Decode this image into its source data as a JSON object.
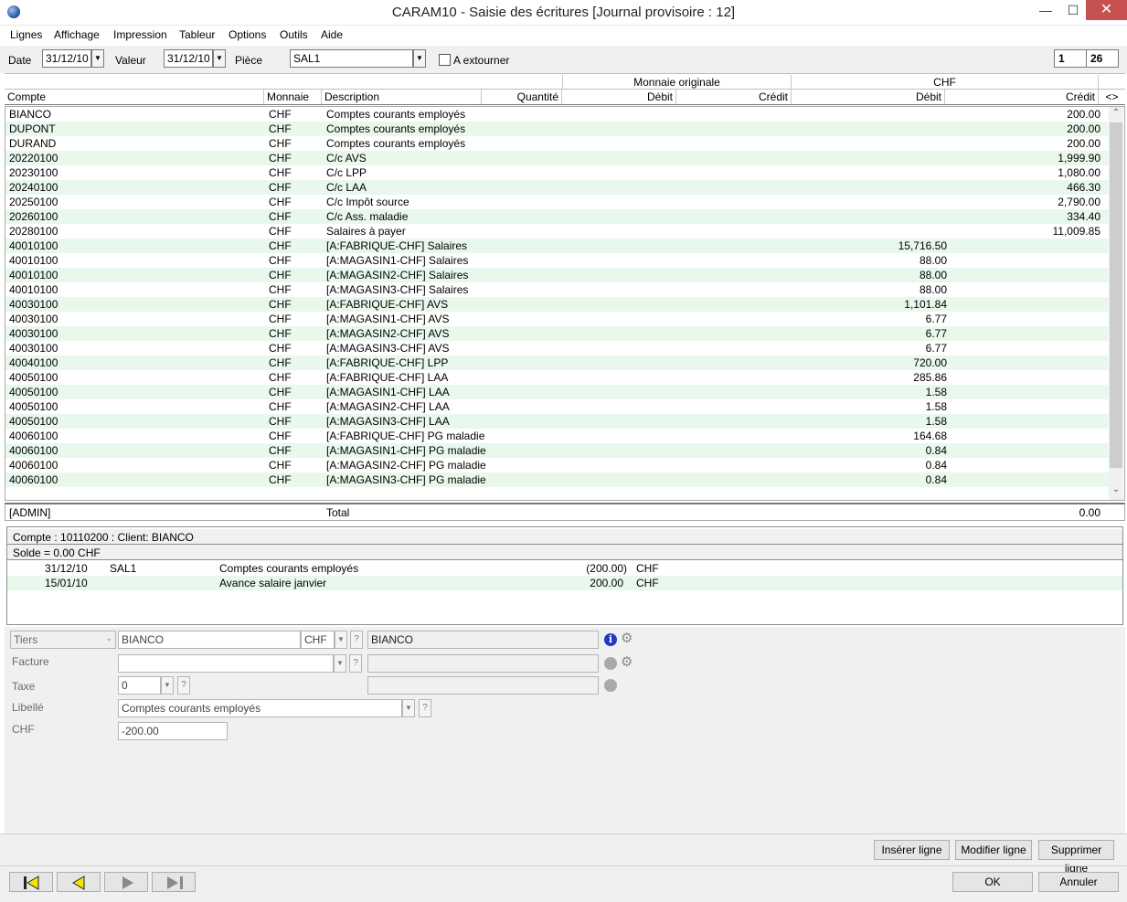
{
  "window": {
    "title": "CARAM10 - Saisie des écritures [Journal provisoire : 12]",
    "minimize": "—",
    "maximize": "☐",
    "close": "✕"
  },
  "menu": [
    "Lignes",
    "Affichage",
    "Impression",
    "Tableur",
    "Options",
    "Outils",
    "Aide"
  ],
  "toolbar": {
    "date_label": "Date",
    "date_value": "31/12/10",
    "valeur_label": "Valeur",
    "valeur_value": "31/12/10",
    "piece_label": "Pièce",
    "piece_value": "SAL1",
    "extourner_label": "A extourner",
    "counter_current": "1",
    "counter_total": "26"
  },
  "grid": {
    "group_original": "Monnaie originale",
    "group_chf": "CHF",
    "columns": [
      "Compte",
      "Monnaie",
      "Description",
      "Quantité",
      "Débit",
      "Crédit",
      "Débit",
      "Crédit",
      "<>"
    ],
    "rows": [
      {
        "compte": "BIANCO",
        "monnaie": "CHF",
        "description": "Comptes courants employés",
        "debit": "",
        "credit": "200.00"
      },
      {
        "compte": "DUPONT",
        "monnaie": "CHF",
        "description": "Comptes courants employés",
        "debit": "",
        "credit": "200.00"
      },
      {
        "compte": "DURAND",
        "monnaie": "CHF",
        "description": "Comptes courants employés",
        "debit": "",
        "credit": "200.00"
      },
      {
        "compte": "20220100",
        "monnaie": "CHF",
        "description": "C/c AVS",
        "debit": "",
        "credit": "1,999.90"
      },
      {
        "compte": "20230100",
        "monnaie": "CHF",
        "description": "C/c LPP",
        "debit": "",
        "credit": "1,080.00"
      },
      {
        "compte": "20240100",
        "monnaie": "CHF",
        "description": "C/c LAA",
        "debit": "",
        "credit": "466.30"
      },
      {
        "compte": "20250100",
        "monnaie": "CHF",
        "description": "C/c Impôt source",
        "debit": "",
        "credit": "2,790.00"
      },
      {
        "compte": "20260100",
        "monnaie": "CHF",
        "description": "C/c Ass. maladie",
        "debit": "",
        "credit": "334.40"
      },
      {
        "compte": "20280100",
        "monnaie": "CHF",
        "description": "Salaires à payer",
        "debit": "",
        "credit": "11,009.85"
      },
      {
        "compte": "40010100",
        "monnaie": "CHF",
        "description": "[A:FABRIQUE-CHF] Salaires",
        "debit": "15,716.50",
        "credit": ""
      },
      {
        "compte": "40010100",
        "monnaie": "CHF",
        "description": "[A:MAGASIN1-CHF] Salaires",
        "debit": "88.00",
        "credit": ""
      },
      {
        "compte": "40010100",
        "monnaie": "CHF",
        "description": "[A:MAGASIN2-CHF] Salaires",
        "debit": "88.00",
        "credit": ""
      },
      {
        "compte": "40010100",
        "monnaie": "CHF",
        "description": "[A:MAGASIN3-CHF] Salaires",
        "debit": "88.00",
        "credit": ""
      },
      {
        "compte": "40030100",
        "monnaie": "CHF",
        "description": "[A:FABRIQUE-CHF] AVS",
        "debit": "1,101.84",
        "credit": ""
      },
      {
        "compte": "40030100",
        "monnaie": "CHF",
        "description": "[A:MAGASIN1-CHF] AVS",
        "debit": "6.77",
        "credit": ""
      },
      {
        "compte": "40030100",
        "monnaie": "CHF",
        "description": "[A:MAGASIN2-CHF] AVS",
        "debit": "6.77",
        "credit": ""
      },
      {
        "compte": "40030100",
        "monnaie": "CHF",
        "description": "[A:MAGASIN3-CHF] AVS",
        "debit": "6.77",
        "credit": ""
      },
      {
        "compte": "40040100",
        "monnaie": "CHF",
        "description": "[A:FABRIQUE-CHF] LPP",
        "debit": "720.00",
        "credit": ""
      },
      {
        "compte": "40050100",
        "monnaie": "CHF",
        "description": "[A:FABRIQUE-CHF] LAA",
        "debit": "285.86",
        "credit": ""
      },
      {
        "compte": "40050100",
        "monnaie": "CHF",
        "description": "[A:MAGASIN1-CHF] LAA",
        "debit": "1.58",
        "credit": ""
      },
      {
        "compte": "40050100",
        "monnaie": "CHF",
        "description": "[A:MAGASIN2-CHF] LAA",
        "debit": "1.58",
        "credit": ""
      },
      {
        "compte": "40050100",
        "monnaie": "CHF",
        "description": "[A:MAGASIN3-CHF] LAA",
        "debit": "1.58",
        "credit": ""
      },
      {
        "compte": "40060100",
        "monnaie": "CHF",
        "description": "[A:FABRIQUE-CHF] PG maladie",
        "debit": "164.68",
        "credit": ""
      },
      {
        "compte": "40060100",
        "monnaie": "CHF",
        "description": "[A:MAGASIN1-CHF] PG maladie",
        "debit": "0.84",
        "credit": ""
      },
      {
        "compte": "40060100",
        "monnaie": "CHF",
        "description": "[A:MAGASIN2-CHF] PG maladie",
        "debit": "0.84",
        "credit": ""
      },
      {
        "compte": "40060100",
        "monnaie": "CHF",
        "description": "[A:MAGASIN3-CHF] PG maladie",
        "debit": "0.84",
        "credit": ""
      }
    ],
    "total_user": "[ADMIN]",
    "total_label": "Total",
    "total_value": "0.00"
  },
  "account_panel": {
    "header": "Compte : 10110200 : Client: BIANCO",
    "solde": "Solde = 0.00  CHF",
    "rows": [
      {
        "date": "31/12/10",
        "piece": "SAL1",
        "label": "Comptes courants employés",
        "amount": "(200.00)",
        "currency": "CHF"
      },
      {
        "date": "15/01/10",
        "piece": "",
        "label": "Avance salaire janvier",
        "amount": "200.00",
        "currency": "CHF"
      }
    ]
  },
  "form": {
    "tiers_label": "Tiers",
    "tiers_value": "BIANCO",
    "tiers_currency": "CHF",
    "tiers_name": "BIANCO",
    "facture_label": "Facture",
    "taxe_label": "Taxe",
    "taxe_value": "0",
    "libelle_label": "Libellé",
    "libelle_value": "Comptes courants employés",
    "chf_label": "CHF",
    "chf_value": "-200.00",
    "help": "?",
    "info": "i"
  },
  "actions": {
    "insert": "Insérer ligne",
    "modify": "Modifier ligne",
    "delete": "Supprimer ligne",
    "ok": "OK",
    "cancel": "Annuler"
  },
  "colors": {
    "alt_row": "#e9f8ec",
    "close_button": "#c75050",
    "info_icon": "#2238c8",
    "nav_arrow": "#f2e600"
  }
}
